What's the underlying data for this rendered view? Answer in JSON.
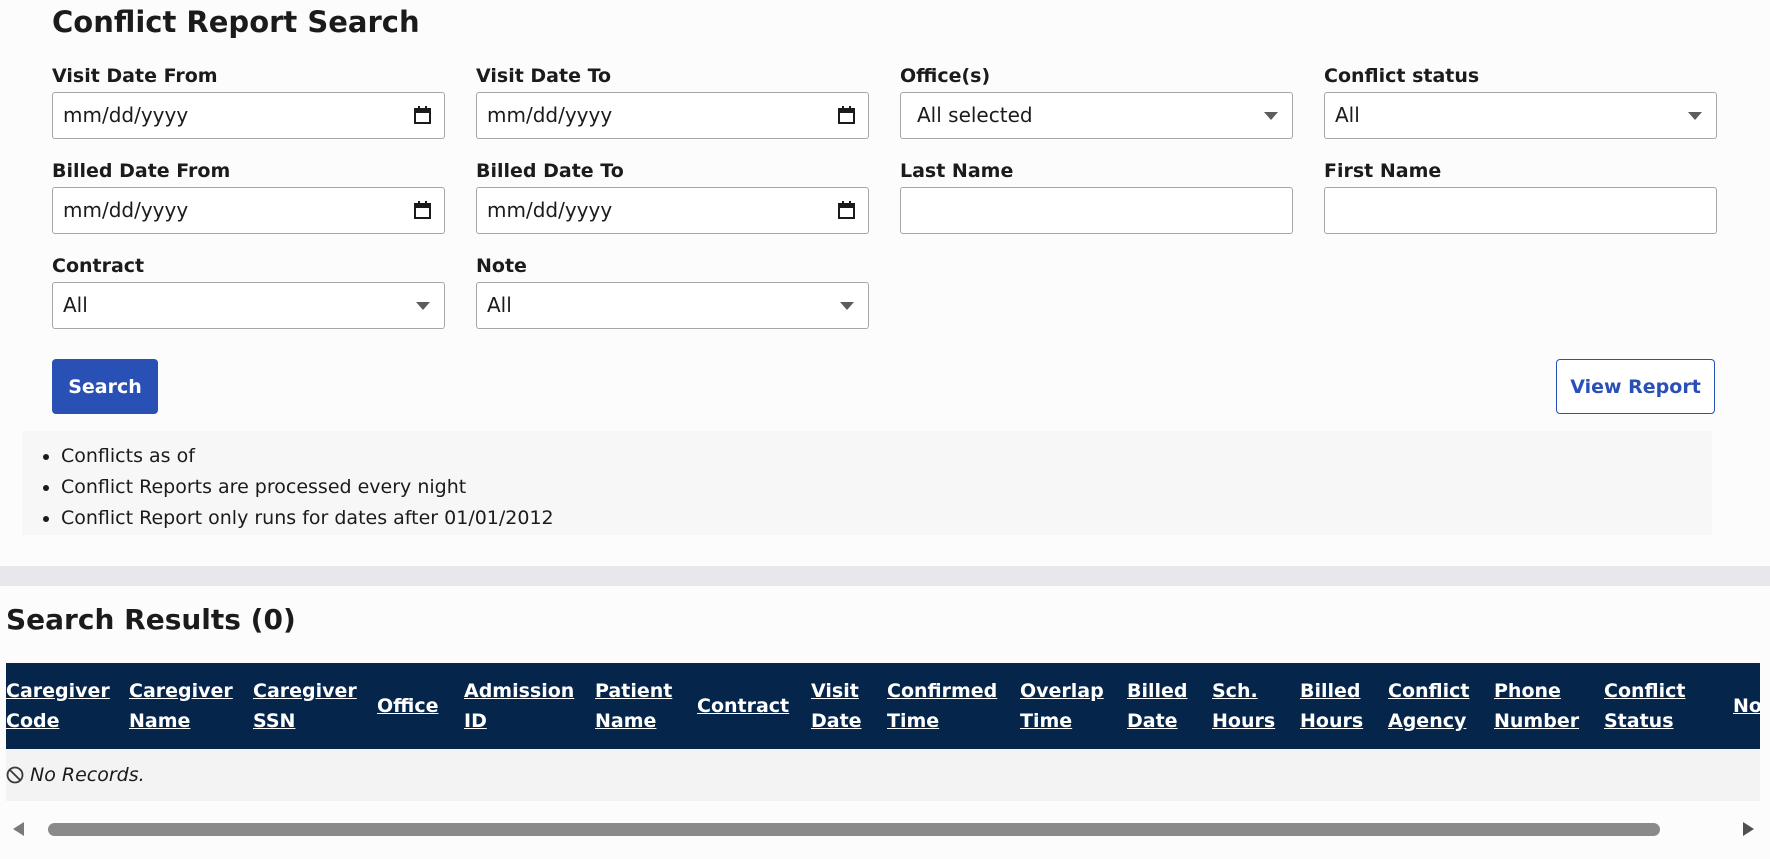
{
  "search": {
    "title": "Conflict Report Search",
    "fields": {
      "visit_date_from": {
        "label": "Visit Date From",
        "value": "mm/dd/yyyy"
      },
      "visit_date_to": {
        "label": "Visit Date To",
        "value": "mm/dd/yyyy"
      },
      "offices": {
        "label": "Office(s)",
        "value": "All selected"
      },
      "conflict_status": {
        "label": "Conflict status",
        "value": "All"
      },
      "billed_date_from": {
        "label": "Billed Date From",
        "value": "mm/dd/yyyy"
      },
      "billed_date_to": {
        "label": "Billed Date To",
        "value": "mm/dd/yyyy"
      },
      "last_name": {
        "label": "Last Name",
        "value": ""
      },
      "first_name": {
        "label": "First Name",
        "value": ""
      },
      "contract": {
        "label": "Contract",
        "value": "All"
      },
      "note": {
        "label": "Note",
        "value": "All"
      }
    },
    "search_button": "Search",
    "view_report_button": "View Report"
  },
  "info": [
    "Conflicts as of",
    "Conflict Reports are processed every night",
    "Conflict Report only runs for dates after 01/01/2012"
  ],
  "results": {
    "title": "Search Results (0)",
    "columns": [
      "Caregiver Code",
      "Caregiver Name",
      "Caregiver SSN",
      "Office",
      "Admission ID",
      "Patient Name",
      "Contract",
      "Visit Date",
      "Confirmed Time",
      "Overlap Time",
      "Billed Date",
      "Sch. Hours",
      "Billed Hours",
      "Conflict Agency",
      "Phone Number",
      "Conflict Status",
      "Note"
    ],
    "empty_message": "No Records."
  },
  "icons": {
    "date_picker": "calendar-icon",
    "dropdown": "chevron-down-icon",
    "empty": "no-entry-icon"
  },
  "colors": {
    "primary": "#2950b5",
    "table_header": "#05264a"
  }
}
